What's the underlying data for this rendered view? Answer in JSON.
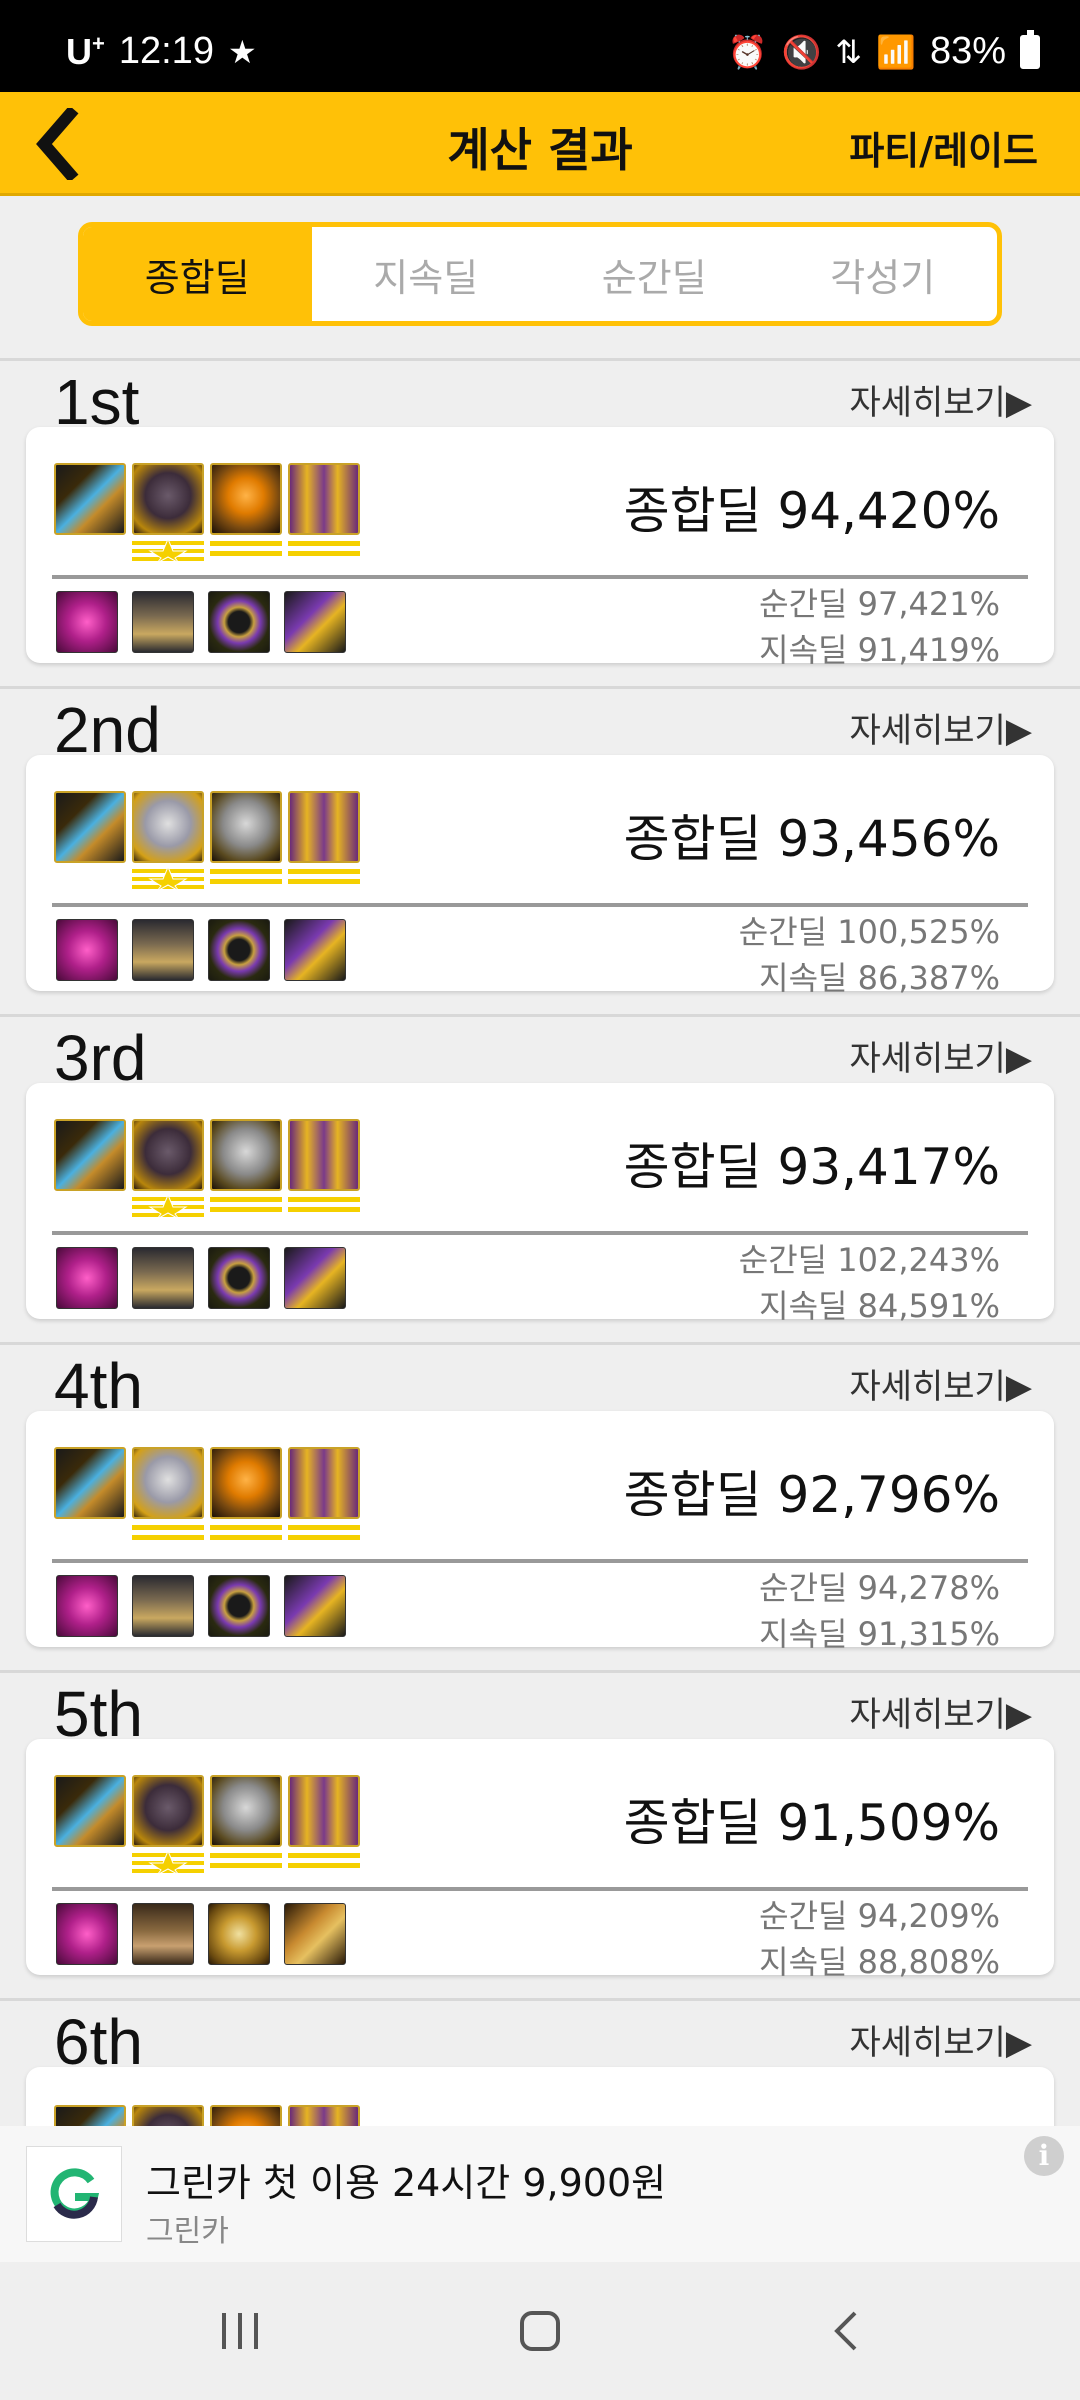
{
  "status_bar": {
    "carrier": "U",
    "carrier_sup": "+",
    "time": "12:19",
    "battery": "83%"
  },
  "header": {
    "title": "계산 결과",
    "action": "파티/레이드"
  },
  "tabs": [
    {
      "label": "종합딜",
      "active": true
    },
    {
      "label": "지속딜",
      "active": false
    },
    {
      "label": "순간딜",
      "active": false
    },
    {
      "label": "각성기",
      "active": false
    }
  ],
  "detail_label": "자세히보기▶",
  "ranks": [
    {
      "rank": "1st",
      "total": "종합딜 94,420%",
      "burst": "순간딜 97,421%",
      "sustain": "지속딜 91,419%"
    },
    {
      "rank": "2nd",
      "total": "종합딜 93,456%",
      "burst": "순간딜 100,525%",
      "sustain": "지속딜 86,387%"
    },
    {
      "rank": "3rd",
      "total": "종합딜 93,417%",
      "burst": "순간딜 102,243%",
      "sustain": "지속딜 84,591%"
    },
    {
      "rank": "4th",
      "total": "종합딜 92,796%",
      "burst": "순간딜 94,278%",
      "sustain": "지속딜 91,315%"
    },
    {
      "rank": "5th",
      "total": "종합딜 91,509%",
      "burst": "순간딜 94,209%",
      "sustain": "지속딜 88,808%"
    },
    {
      "rank": "6th"
    }
  ],
  "ad": {
    "title": "그린카 첫 이용 24시간 9,900원",
    "subtitle": "그린카",
    "info": "i"
  }
}
